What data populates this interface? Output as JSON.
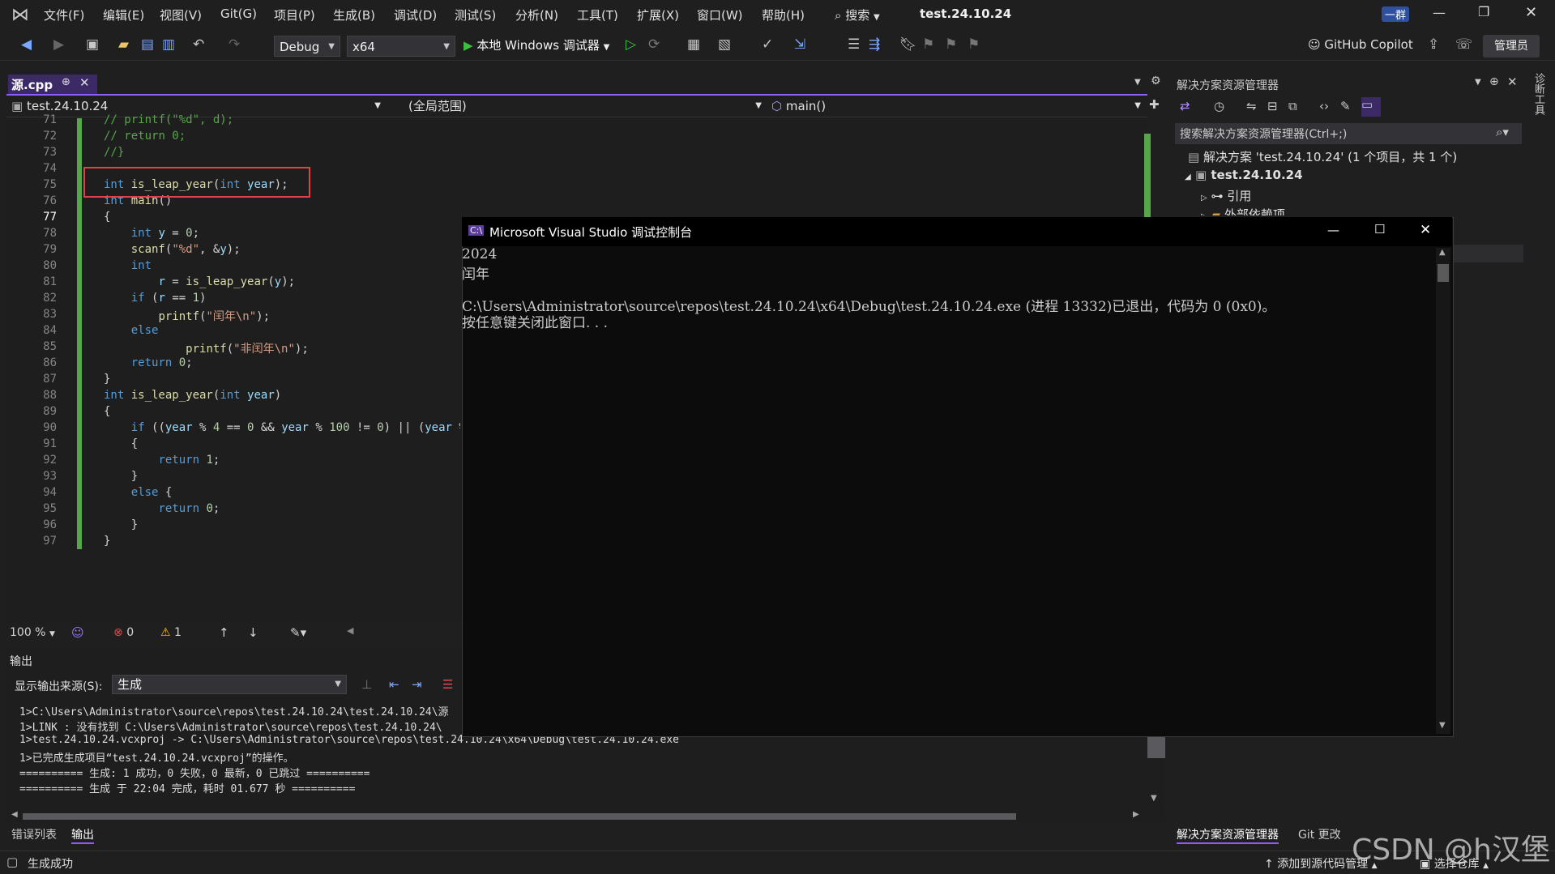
{
  "titlebar": {
    "menus": [
      "文件(F)",
      "编辑(E)",
      "视图(V)",
      "Git(G)",
      "项目(P)",
      "生成(B)",
      "调试(D)",
      "测试(S)",
      "分析(N)",
      "工具(T)",
      "扩展(X)",
      "窗口(W)",
      "帮助(H)"
    ],
    "search_label": "搜索",
    "solution_title": "test.24.10.24",
    "user_badge": "一群"
  },
  "toolbar": {
    "config": "Debug",
    "platform": "x64",
    "debugger": "本地 Windows 调试器",
    "copilot": "GitHub Copilot",
    "admin": "管理员"
  },
  "editor": {
    "tab_label": "源.cpp",
    "nav_project": "test.24.10.24",
    "nav_scope": "(全局范围)",
    "nav_member": "main()",
    "line_numbers": [
      "71",
      "72",
      "73",
      "74",
      "75",
      "76",
      "77",
      "78",
      "79",
      "80",
      "81",
      "82",
      "83",
      "84",
      "85",
      "86",
      "87",
      "88",
      "89",
      "90",
      "91",
      "92",
      "93",
      "94",
      "95",
      "96",
      "97"
    ],
    "zoom": "100 %",
    "errors": "0",
    "warnings": "1"
  },
  "output": {
    "title": "输出",
    "source_label": "显示输出来源(S):",
    "source_value": "生成",
    "lines": [
      "1>C:\\Users\\Administrator\\source\\repos\\test.24.10.24\\test.24.10.24\\源",
      "1>LINK : 没有找到 C:\\Users\\Administrator\\source\\repos\\test.24.10.24\\",
      "1>test.24.10.24.vcxproj -> C:\\Users\\Administrator\\source\\repos\\test.24.10.24\\x64\\Debug\\test.24.10.24.exe",
      "1>已完成生成项目“test.24.10.24.vcxproj”的操作。",
      "========== 生成: 1 成功，0 失败，0 最新，0 已跳过 ==========",
      "========== 生成 于 22:04 完成，耗时 01.677 秒 =========="
    ],
    "bottom_tabs": [
      "错误列表",
      "输出"
    ]
  },
  "console": {
    "title": "Microsoft Visual Studio 调试控制台",
    "lines": [
      "2024",
      "闰年",
      "",
      "C:\\Users\\Administrator\\source\\repos\\test.24.10.24\\x64\\Debug\\test.24.10.24.exe (进程 13332)已退出，代码为 0 (0x0)。",
      "按任意键关闭此窗口. . ."
    ]
  },
  "solution_explorer": {
    "title": "解决方案资源管理器",
    "search_placeholder": "搜索解决方案资源管理器(Ctrl+;)",
    "solution_line": "解决方案 'test.24.10.24' (1 个项目，共 1 个)",
    "project": "test.24.10.24",
    "references": "引用",
    "external_deps": "外部依赖项",
    "bottom_tabs": [
      "解决方案资源管理器",
      "Git 更改"
    ],
    "side_tab": "诊断工具"
  },
  "statusbar": {
    "message": "生成成功",
    "source_control": "添加到源代码管理",
    "repo": "选择仓库",
    "watermark": "CSDN @h汉堡"
  },
  "colors": {
    "accent": "#8b5cf6",
    "changed_bar": "#57a64a",
    "highlight_border": "#e0404a"
  }
}
